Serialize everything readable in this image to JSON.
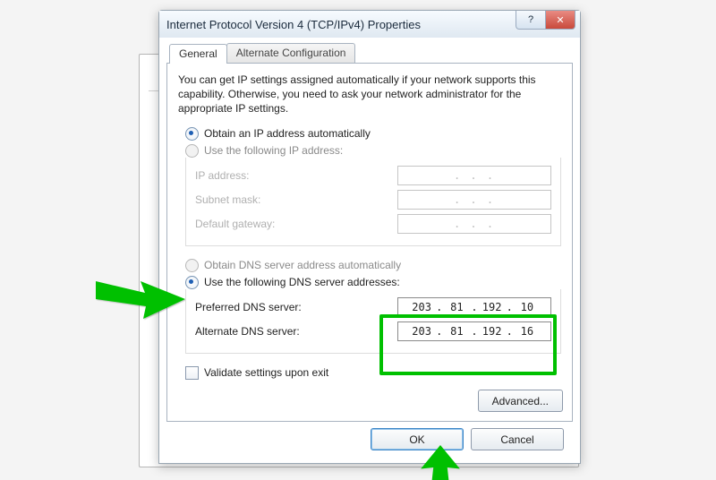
{
  "window": {
    "title": "Internet Protocol Version 4 (TCP/IPv4) Properties",
    "help_glyph": "?",
    "close_glyph": "✕"
  },
  "tabs": {
    "general": "General",
    "alt": "Alternate Configuration"
  },
  "description": "You can get IP settings assigned automatically if your network supports this capability. Otherwise, you need to ask your network administrator for the appropriate IP settings.",
  "ip_section": {
    "radio_auto": "Obtain an IP address automatically",
    "radio_manual": "Use the following IP address:",
    "field_ip": "IP address:",
    "field_mask": "Subnet mask:",
    "field_gw": "Default gateway:",
    "placeholder": ".       .       ."
  },
  "dns_section": {
    "radio_auto": "Obtain DNS server address automatically",
    "radio_manual": "Use the following DNS server addresses:",
    "field_pref": "Preferred DNS server:",
    "field_alt": "Alternate DNS server:",
    "pref_value": {
      "o1": "203",
      "o2": "81",
      "o3": "192",
      "o4": "10"
    },
    "alt_value": {
      "o1": "203",
      "o2": "81",
      "o3": "192",
      "o4": "16"
    }
  },
  "validate_label": "Validate settings upon exit",
  "buttons": {
    "advanced": "Advanced...",
    "ok": "OK",
    "cancel": "Cancel"
  },
  "colors": {
    "accent": "#1e5fb4",
    "highlight": "#00c000"
  }
}
